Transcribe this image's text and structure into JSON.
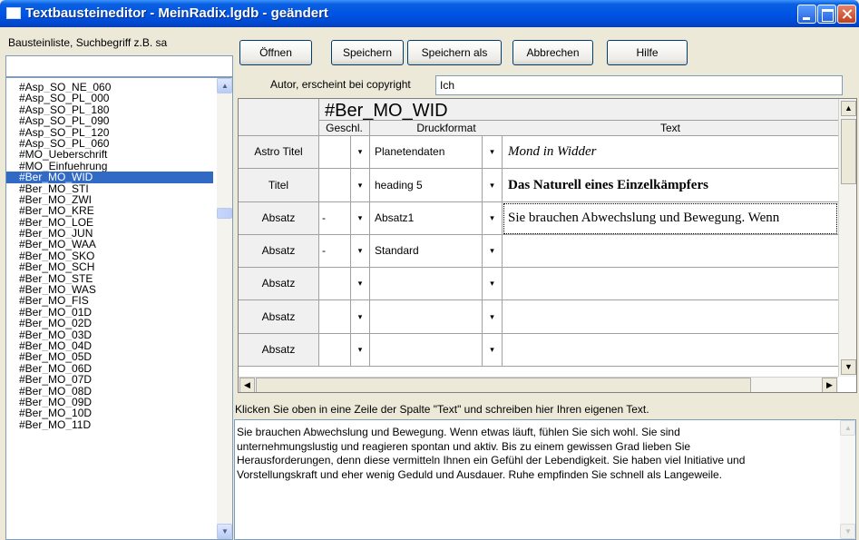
{
  "window": {
    "title": "Textbausteineditor - MeinRadix.lgdb - geändert"
  },
  "left": {
    "label": "Bausteinliste, Suchbegriff z.B. sa",
    "search_value": "",
    "items": [
      "#Asp_SO_NE_060",
      "#Asp_SO_PL_000",
      "#Asp_SO_PL_180",
      "#Asp_SO_PL_090",
      "#Asp_SO_PL_120",
      "#Asp_SO_PL_060",
      "#MO_Ueberschrift",
      "#MO_Einfuehrung",
      "#Ber_MO_WID",
      "#Ber_MO_STI",
      "#Ber_MO_ZWI",
      "#Ber_MO_KRE",
      "#Ber_MO_LOE",
      "#Ber_MO_JUN",
      "#Ber_MO_WAA",
      "#Ber_MO_SKO",
      "#Ber_MO_SCH",
      "#Ber_MO_STE",
      "#Ber_MO_WAS",
      "#Ber_MO_FIS",
      "#Ber_MO_01D",
      "#Ber_MO_02D",
      "#Ber_MO_03D",
      "#Ber_MO_04D",
      "#Ber_MO_05D",
      "#Ber_MO_06D",
      "#Ber_MO_07D",
      "#Ber_MO_08D",
      "#Ber_MO_09D",
      "#Ber_MO_10D",
      "#Ber_MO_11D"
    ],
    "selected_index": 8
  },
  "toolbar": {
    "open": "Öffnen",
    "save": "Speichern",
    "save_as": "Speichern als",
    "cancel": "Abbrechen",
    "help": "Hilfe"
  },
  "author": {
    "label": "Autor, erscheint bei copyright",
    "value": "Ich"
  },
  "grid": {
    "block_title": "#Ber_MO_WID",
    "headers": {
      "gender": "Geschl.",
      "format": "Druckformat",
      "text": "Text"
    },
    "rows": [
      {
        "type": "Astro Titel",
        "gender": "",
        "format": "Planetendaten",
        "text": "Mond in Widder",
        "style": "serif-it"
      },
      {
        "type": "Titel",
        "gender": "",
        "format": "heading 5",
        "text": "Das Naturell eines Einzelkämpfers",
        "style": "serif-b"
      },
      {
        "type": "Absatz",
        "gender": "-",
        "format": "Absatz1",
        "text": "Sie brauchen Abwechslung und Bewegung. Wenn",
        "style": "serif"
      },
      {
        "type": "Absatz",
        "gender": "-",
        "format": "Standard",
        "text": "",
        "style": ""
      },
      {
        "type": "Absatz",
        "gender": "",
        "format": "",
        "text": "",
        "style": ""
      },
      {
        "type": "Absatz",
        "gender": "",
        "format": "",
        "text": "",
        "style": ""
      },
      {
        "type": "Absatz",
        "gender": "",
        "format": "",
        "text": "",
        "style": ""
      }
    ]
  },
  "hint": "Klicken Sie oben in eine Zeile der Spalte \"Text\" und schreiben hier Ihren eigenen Text.",
  "editor": {
    "lines": [
      "Sie brauchen Abwechslung und Bewegung. Wenn etwas läuft, fühlen Sie sich wohl. Sie sind",
      "unternehmungslustig und reagieren spontan und aktiv. Bis zu einem gewissen Grad lieben Sie",
      "Herausforderungen, denn diese vermitteln Ihnen ein Gefühl der Lebendigkeit. Sie haben viel Initiative und",
      "Vorstellungskraft und eher wenig Geduld und Ausdauer. Ruhe empfinden Sie schnell als Langeweile."
    ]
  },
  "icons": {
    "dropdown": "▾",
    "up": "▲",
    "down": "▼",
    "left": "◀",
    "right": "▶"
  },
  "colors": {
    "selection": "#316ac5",
    "titlebar": "#0055e5",
    "window_bg": "#ece9d8"
  }
}
